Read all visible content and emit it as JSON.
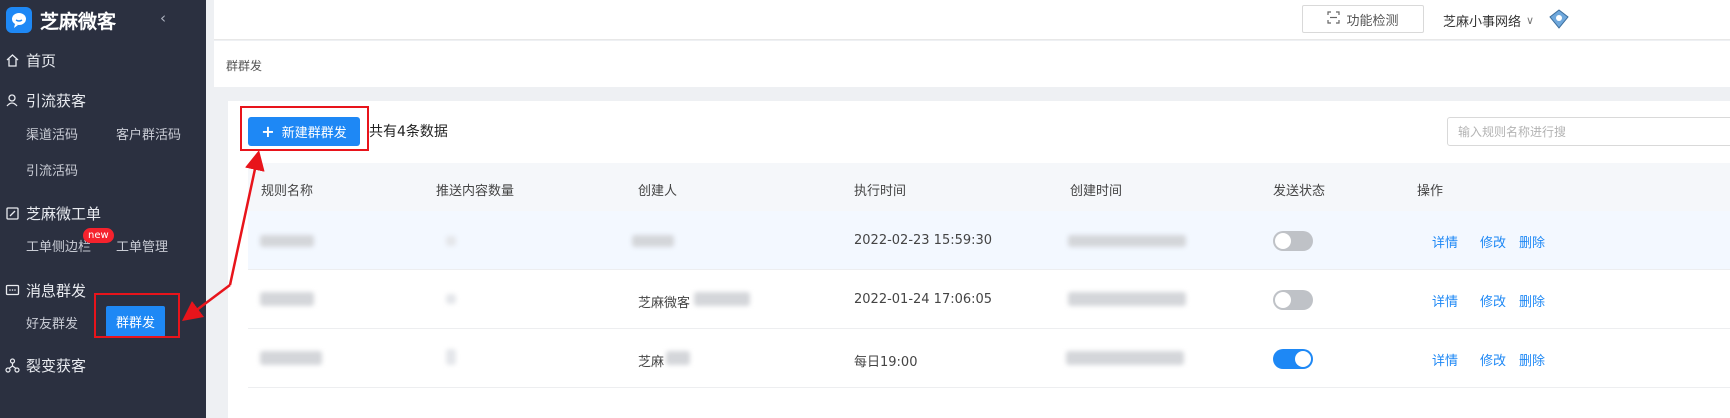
{
  "sidebar": {
    "brand": "芝麻微客",
    "collapse_icon": "chevron-left-icon",
    "groups": [
      {
        "label": "首页",
        "icon": "home-icon"
      },
      {
        "label": "引流获客",
        "icon": "user-icon",
        "items": [
          "渠道活码",
          "客户群活码",
          "引流活码"
        ]
      },
      {
        "label": "芝麻微工单",
        "icon": "edit-icon",
        "items": [
          "工单侧边栏",
          "工单管理"
        ]
      },
      {
        "label": "消息群发",
        "icon": "message-icon",
        "items": [
          "好友群发",
          "群群发"
        ]
      },
      {
        "label": "裂变获客",
        "icon": "network-icon"
      }
    ],
    "new_badge": "new",
    "active_item": "群群发"
  },
  "topbar": {
    "detect_label": "功能检测",
    "account_name": "芝麻小事网络"
  },
  "breadcrumb": "群群发",
  "toolbar": {
    "new_button": "新建群群发",
    "count_text": "共有4条数据",
    "search_placeholder": "输入规则名称进行搜"
  },
  "table": {
    "columns": [
      "规则名称",
      "推送内容数量",
      "创建人",
      "执行时间",
      "创建时间",
      "发送状态",
      "操作"
    ],
    "rows": [
      {
        "creator": "",
        "exec_time": "2022-02-23 15:59:30",
        "status_on": false,
        "ops": [
          "详情",
          "修改",
          "删除"
        ]
      },
      {
        "creator": "芝麻微客",
        "exec_time": "2022-01-24 17:06:05",
        "status_on": false,
        "ops": [
          "详情",
          "修改",
          "删除"
        ]
      },
      {
        "creator": "芝麻",
        "exec_time": "每日19:00",
        "status_on": true,
        "ops": [
          "详情",
          "修改",
          "删除"
        ]
      }
    ]
  },
  "colors": {
    "sidebar_bg": "#2b3040",
    "accent": "#1e88f5",
    "annotation": "#e8141b"
  }
}
